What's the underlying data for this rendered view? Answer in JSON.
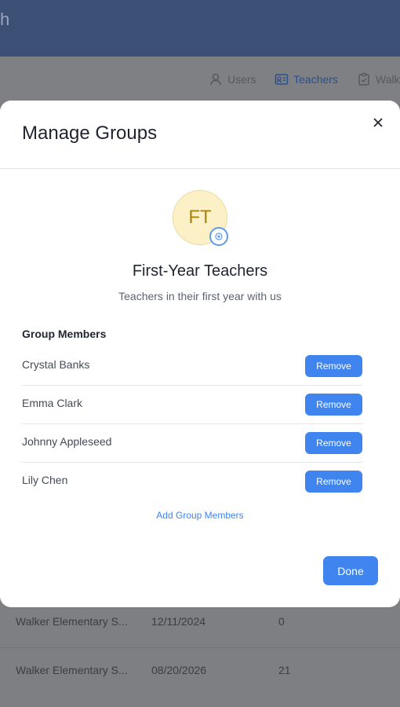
{
  "background": {
    "header_title": "h",
    "tabs": [
      {
        "label": "Users",
        "icon": "user-icon"
      },
      {
        "label": "Teachers",
        "icon": "id-card-icon"
      },
      {
        "label": "Walk",
        "icon": "clipboard-check-icon"
      }
    ],
    "rows": [
      {
        "school": "Walker Elementary S...",
        "date": "12/11/2024",
        "count": "0"
      },
      {
        "school": "Walker Elementary S...",
        "date": "08/20/2026",
        "count": "21"
      }
    ]
  },
  "modal": {
    "title": "Manage Groups",
    "avatar_initials": "FT",
    "group_name": "First-Year Teachers",
    "group_description": "Teachers in their first year with us",
    "members_label": "Group Members",
    "members": [
      {
        "name": "Crystal Banks",
        "action": "Remove"
      },
      {
        "name": "Emma Clark",
        "action": "Remove"
      },
      {
        "name": "Johnny Appleseed",
        "action": "Remove"
      },
      {
        "name": "Lily Chen",
        "action": "Remove"
      }
    ],
    "add_link": "Add Group Members",
    "done_label": "Done"
  },
  "colors": {
    "accent": "#3f84ef",
    "header": "#3c5075",
    "avatar_bg": "#fbf0c6",
    "avatar_text": "#a8850f"
  }
}
